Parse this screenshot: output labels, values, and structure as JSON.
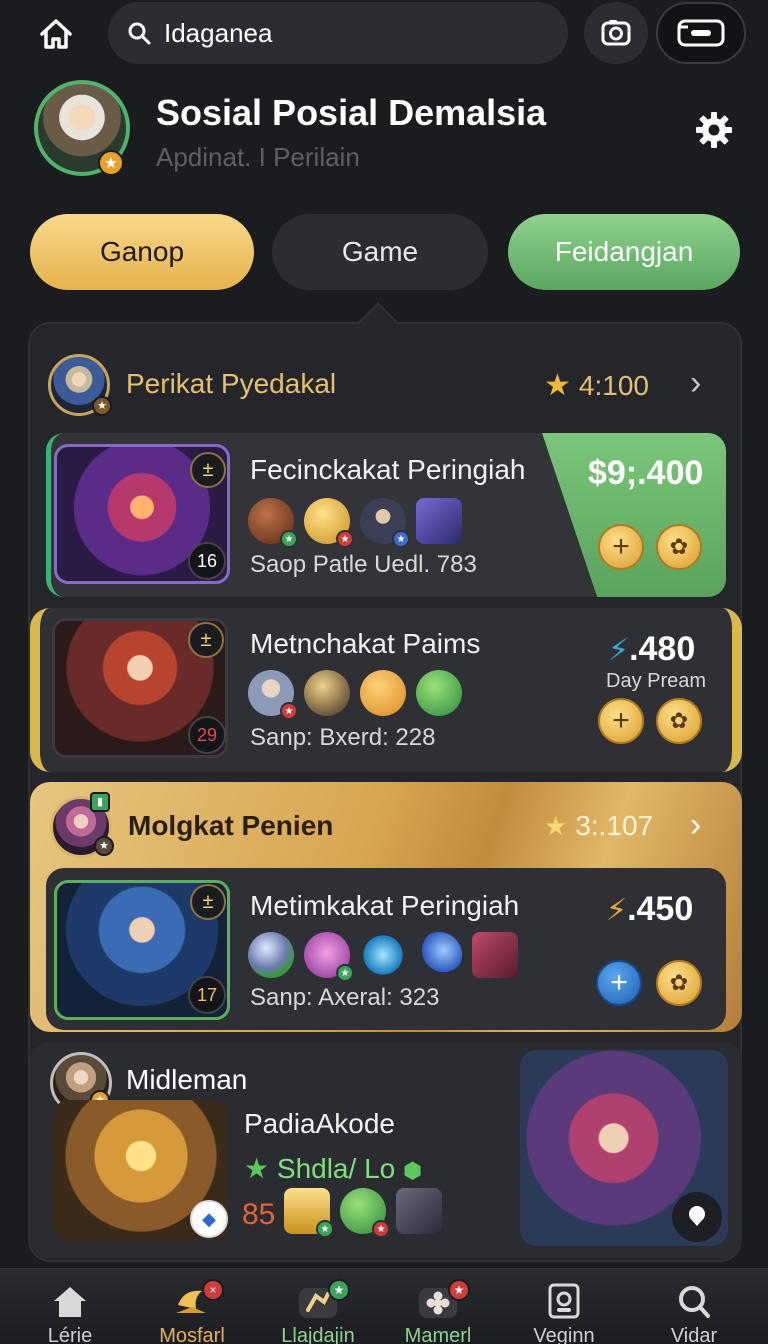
{
  "header": {
    "search_query": "Idaganea",
    "home_icon": "home-icon",
    "camera_icon": "camera-icon",
    "wallet_icon": "wallet-icon"
  },
  "profile": {
    "name": "Sosial Posial Demalsia",
    "subtitle": "Apdinat. I Perilain",
    "settings_icon": "gear-icon"
  },
  "tabs": [
    {
      "label": "Ganop",
      "color": "#f0c86a"
    },
    {
      "label": "Game",
      "color": "#2c2d32"
    },
    {
      "label": "Feidangjan",
      "color": "#72b872"
    }
  ],
  "section1": {
    "title": "Perikat Pyedakal",
    "score": "4:100",
    "title_color": "#e6c06a"
  },
  "cards": [
    {
      "title": "Fecinckakat Peringiah",
      "subtitle": "Saop Patle Uedl. 783",
      "badge_top": "±",
      "badge_bottom": "16",
      "price": "$9;.400",
      "price_sub": ""
    },
    {
      "title": "Metnchakat Paims",
      "subtitle": "Sanp: Bxerd: 228",
      "badge_top": "±",
      "badge_bottom": "29",
      "price": ".480",
      "price_sub": "Day Pream"
    },
    {
      "title": "Metimkakat Peringiah",
      "subtitle": "Sanp: Axeral: 323",
      "badge_top": "±",
      "badge_bottom": "17",
      "price": ".450",
      "price_sub": ""
    }
  ],
  "section2": {
    "title": "Molgkat Penien",
    "score": "3:.107"
  },
  "section3": {
    "title": "Midleman",
    "item_title": "PadiaAkode",
    "item_tag": "Shdla/ Lo",
    "item_count": "85"
  },
  "bottom_nav": [
    {
      "label": "Lérie",
      "icon": "home-icon",
      "color": "#cfcfcf"
    },
    {
      "label": "Mosfarl",
      "icon": "trophy-icon",
      "color": "#e6b24c"
    },
    {
      "label": "Llajdajin",
      "icon": "chest-icon",
      "color": "#8fd28d"
    },
    {
      "label": "Mamerl",
      "icon": "flower-icon",
      "color": "#8fd28d"
    },
    {
      "label": "Veginn",
      "icon": "profile-card-icon",
      "color": "#cfcfcf"
    },
    {
      "label": "Vidar",
      "icon": "search-icon",
      "color": "#cfcfcf"
    }
  ]
}
